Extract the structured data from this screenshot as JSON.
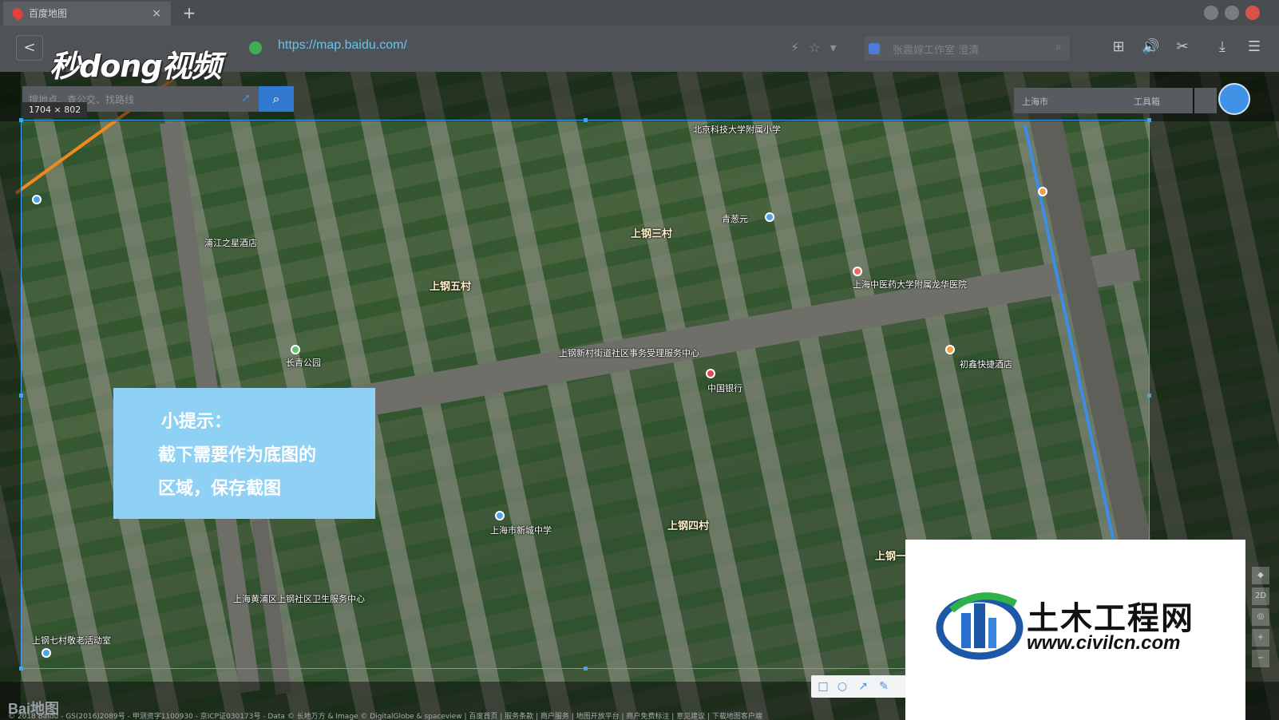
{
  "browser": {
    "tab_title": "百度地图",
    "tab_close": "×",
    "new_tab": "+",
    "back": "<",
    "url": "https://map.baidu.com/",
    "search_placeholder": "张震嫁工作室 澄清",
    "search_icon": "⌕"
  },
  "map": {
    "search_placeholder": "搜地点、查公交、找路线",
    "search_btn": "⌕",
    "selection_size": "1704 × 802",
    "city": "上海市",
    "toolbox": "工具箱",
    "labels": [
      "上钢三村",
      "上钢五村",
      "上钢四村",
      "上钢一村",
      "长青公园",
      "中国银行",
      "上海市新城中学",
      "浦江之星酒店",
      "上海中医药大学附属龙华医院",
      "北京科技大学附属小学",
      "上钢新村街道社区事务受理服务中心",
      "初鑫快捷酒店",
      "上钢七村敬老活动室",
      "上海黄浦区上钢社区卫生服务中心",
      "青葱元"
    ],
    "footer_logo": "Bai地图",
    "copyright": "© 2018 Baidu - GS(2016)2089号 - 甲测资字1100930 - 京ICP证030173号 - Data © 长地万方 & Image © DigitalGlobe & spaceview | 百度首页 | 服务条款 | 商户服务 | 地图开放平台 | 商户免费标注 | 意见建议 | 下载地图客户端"
  },
  "tip": {
    "title": "小提示：",
    "line1": "截下需要作为底图的",
    "line2": "区域，保存截图"
  },
  "watermarks": {
    "mdsp": "秒dong视频",
    "civil_name": "土木工程网",
    "civil_url": "www.civilcn.com"
  },
  "colors": {
    "url": "#63c6f0",
    "tip_bg": "#8fd0f5",
    "selection": "#3fa7ef",
    "search_btn": "#3279d2"
  }
}
